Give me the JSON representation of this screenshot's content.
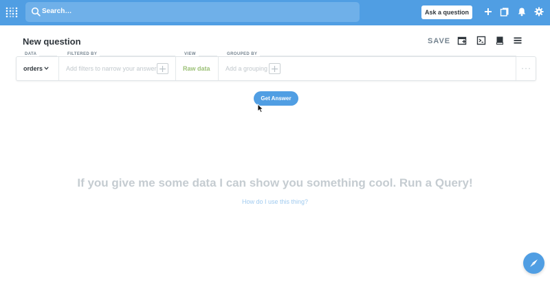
{
  "navbar": {
    "search_placeholder": "Search…",
    "ask_button": "Ask a question"
  },
  "header": {
    "title": "New question",
    "save_label": "SAVE"
  },
  "builder": {
    "data_label": "DATA",
    "data_value": "orders",
    "filter_label": "FILTERED BY",
    "filter_hint": "Add filters to narrow your answer",
    "view_label": "VIEW",
    "view_value": "Raw data",
    "group_label": "GROUPED BY",
    "group_hint": "Add a grouping",
    "more": "···"
  },
  "actions": {
    "get_answer": "Get Answer"
  },
  "empty_state": {
    "message": "If you give me some data I can show you something cool. Run a Query!",
    "help_link": "How do I use this thing?"
  },
  "colors": {
    "brand": "#509ee3",
    "raw_data": "#9cc177"
  }
}
